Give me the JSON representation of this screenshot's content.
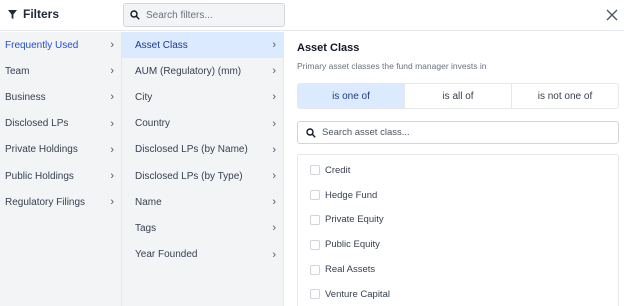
{
  "header": {
    "title": "Filters",
    "search_placeholder": "Search filters..."
  },
  "categories": [
    {
      "label": "Frequently Used",
      "active": true
    },
    {
      "label": "Team"
    },
    {
      "label": "Business"
    },
    {
      "label": "Disclosed LPs"
    },
    {
      "label": "Private Holdings"
    },
    {
      "label": "Public Holdings"
    },
    {
      "label": "Regulatory Filings"
    }
  ],
  "filters": [
    {
      "label": "Asset Class",
      "active": true
    },
    {
      "label": "AUM (Regulatory) (mm)"
    },
    {
      "label": "City"
    },
    {
      "label": "Country"
    },
    {
      "label": "Disclosed LPs (by Name)"
    },
    {
      "label": "Disclosed LPs (by Type)"
    },
    {
      "label": "Name"
    },
    {
      "label": "Tags"
    },
    {
      "label": "Year Founded"
    }
  ],
  "panel": {
    "title": "Asset Class",
    "subtitle": "Primary asset classes the fund manager invests in",
    "operators": [
      "is one of",
      "is all of",
      "is not one of"
    ],
    "selected_operator": "is one of",
    "search_placeholder": "Search asset class...",
    "options": [
      "Credit",
      "Hedge Fund",
      "Private Equity",
      "Public Equity",
      "Real Assets",
      "Venture Capital"
    ]
  },
  "colors": {
    "accent": "#1d4ed8",
    "active_bg": "#dbeafe",
    "sidebar_bg": "#f3f4f6"
  }
}
